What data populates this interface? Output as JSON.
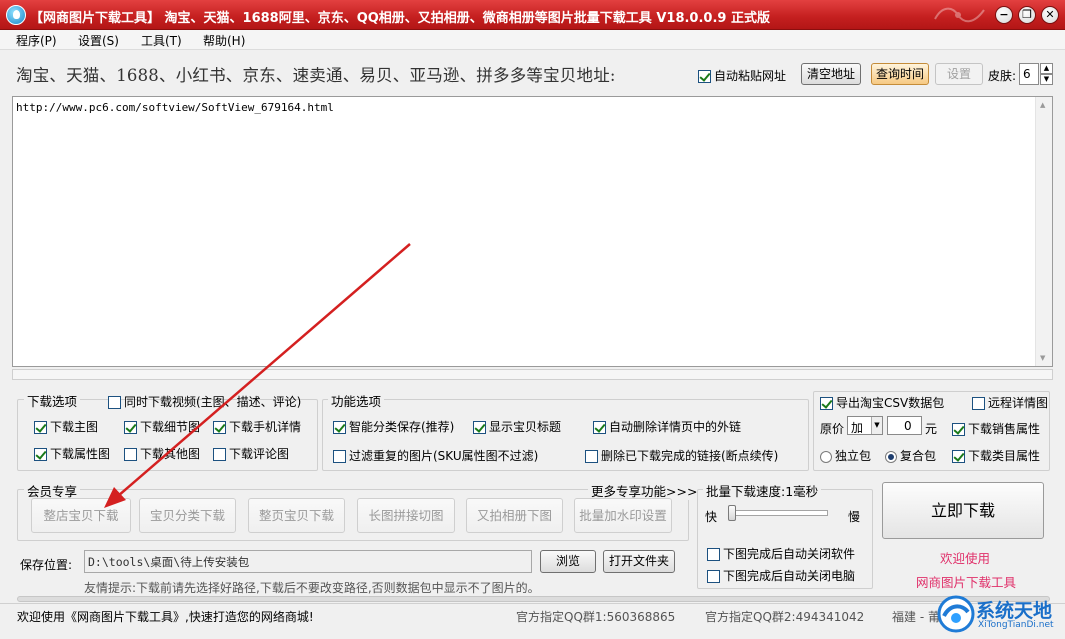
{
  "window": {
    "title": "【网商图片下载工具】 淘宝、天猫、1688阿里、京东、QQ相册、又拍相册、微商相册等图片批量下载工具 V18.0.0.9 正式版",
    "minimize": "−",
    "restore": "❐",
    "close": "✕"
  },
  "menu": [
    "程序(P)",
    "设置(S)",
    "工具(T)",
    "帮助(H)"
  ],
  "address_bar": {
    "label": "淘宝、天猫、1688、小红书、京东、速卖通、易贝、亚马逊、拼多多等宝贝地址:",
    "auto_paste": {
      "label": "自动粘贴网址",
      "checked": true
    },
    "clear_button": "清空地址",
    "query_time_button": "查询时间",
    "settings_button": "设置",
    "skin_label": "皮肤:",
    "skin_value": "6"
  },
  "url_input": {
    "value": "http://www.pc6.com/softview/SoftView_679164.html"
  },
  "download_options": {
    "title": "下载选项",
    "video": {
      "label": "同时下载视频(主图、描述、评论)",
      "checked": false
    },
    "items": [
      {
        "label": "下载主图",
        "checked": true
      },
      {
        "label": "下载细节图",
        "checked": true
      },
      {
        "label": "下载手机详情",
        "checked": true
      },
      {
        "label": "下载属性图",
        "checked": true
      },
      {
        "label": "下载其他图",
        "checked": false
      },
      {
        "label": "下载评论图",
        "checked": false
      }
    ]
  },
  "function_options": {
    "title": "功能选项",
    "items": [
      {
        "label": "智能分类保存(推荐)",
        "checked": true
      },
      {
        "label": "显示宝贝标题",
        "checked": true
      },
      {
        "label": "自动删除详情页中的外链",
        "checked": true
      },
      {
        "label": "过滤重复的图片(SKU属性图不过滤)",
        "checked": false
      },
      {
        "label": "删除已下载完成的链接(断点续传)",
        "checked": false
      }
    ]
  },
  "export_options": {
    "export_csv": {
      "label": "导出淘宝CSV数据包",
      "checked": true
    },
    "remote_detail": {
      "label": "远程详情图",
      "checked": false
    },
    "price_label": "原价",
    "price_op": "加",
    "price_value": "0",
    "price_unit": "元",
    "sales_attr": {
      "label": "下载销售属性",
      "checked": true
    },
    "single_pkg": {
      "label": "独立包",
      "checked": false
    },
    "combo_pkg": {
      "label": "复合包",
      "checked": true
    },
    "category_attr": {
      "label": "下载类目属性",
      "checked": true
    }
  },
  "member": {
    "title": "会员专享",
    "more_link": "更多专享功能>>>",
    "buttons": [
      "整店宝贝下载",
      "宝贝分类下载",
      "整页宝贝下载",
      "长图拼接切图",
      "又拍相册下图",
      "批量加水印设置"
    ]
  },
  "batch": {
    "title": "批量下载速度:1毫秒",
    "fast": "快",
    "slow": "慢",
    "speed_level": 0.0,
    "close_software": {
      "label": "下图完成后自动关闭软件",
      "checked": false
    },
    "shutdown": {
      "label": "下图完成后自动关闭电脑",
      "checked": false
    }
  },
  "download_now": "立即下载",
  "welcome": {
    "line1": "欢迎使用",
    "line2": "网商图片下载工具"
  },
  "save": {
    "label": "保存位置:",
    "path": "D:\\tools\\桌面\\待上传安装包",
    "browse": "浏览",
    "open_folder": "打开文件夹",
    "tip": "友情提示:下载前请先选择好路径,下载后不要改变路径,否则数据包中显示不了图片的。"
  },
  "status": {
    "message": "欢迎使用《网商图片下载工具》,快速打造您的网络商城!",
    "qq1": "官方指定QQ群1:560368865",
    "qq2": "官方指定QQ群2:494341042",
    "region": "福建 - 莆"
  },
  "watermark": {
    "name": "系统天地",
    "url": "XiTongTianDi.net"
  },
  "colors": {
    "titlebar": "#c41f1f",
    "accent_text": "#e0306a",
    "arrow": "#d42020"
  }
}
